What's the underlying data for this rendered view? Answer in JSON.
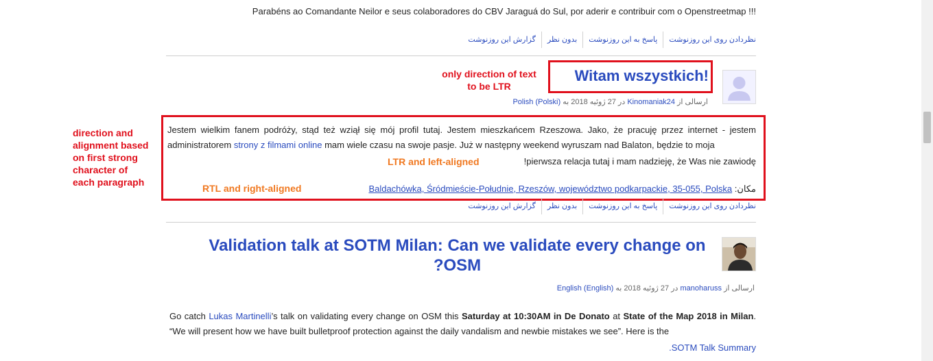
{
  "top_text": "!!! Parabéns ao Comandante Neilor e seus colaboradores do CBV Jaraguá do Sul, por aderir e contribuir com o Openstreetmap",
  "entry_actions": [
    "نظردادن روی این روزنوشت",
    "پاسخ به این روزنوشت",
    "بدون نظر",
    "گزارش این روزنوشت"
  ],
  "post1": {
    "title": "!Witam wszystkich",
    "meta_prefix": "ارسالی از",
    "author": "Kinomaniak24",
    "date": "در 27 ژوئیه 2018 به",
    "language": "Polish (Polski)",
    "body_part1": "Jestem wielkim fanem podróży, stąd też wziął się mój profil tutaj. Jestem mieszkańcem Rzeszowa. Jako, że pracuję przez internet - jestem administratorem",
    "body_link": "strony z filmami online",
    "body_part2": "mam wiele czasu na swoje pasje. Już w następny weekend wyruszam nad Balaton, będzie to moja",
    "body_line3": "!pierwsza relacja tutaj i mam nadzieję, że Was nie zawiodę",
    "location_label": "مکان:",
    "location_value": "Baldachówka, Śródmieście-Południe, Rzeszów, województwo podkarpackie, 35-055, Polska"
  },
  "annotations": {
    "title_note_line1": "only direction of text",
    "title_note_line2": "to be LTR",
    "left_note": [
      "direction and",
      "alignment based",
      "on first strong",
      "character of",
      "each paragraph"
    ],
    "ltr_note": "LTR and left-aligned",
    "rtl_note": "RTL and right-aligned"
  },
  "post2": {
    "title": "Validation talk at SOTM Milan: Can we validate every change on ?OSM",
    "meta_prefix": "ارسالی از",
    "author": "manoharuss",
    "date": "در 27 ژوئیه 2018 به",
    "language": "English (English)",
    "body_intro": "Go catch",
    "body_link": "Lukas Martinelli",
    "body_mid": "’s talk on validating every change on OSM this",
    "body_bold1": "Saturday at 10:30AM in De Donato",
    "body_at": "at",
    "body_bold2": "State of the Map 2018 in",
    "body_bold3": "Milan",
    "body_quote": ". “We will present how we have built bulletproof protection against the daily vandalism and newbie mistakes we see”. Here is the",
    "body_link2": ".SOTM Talk Summary"
  },
  "colors": {
    "link": "#2a4bbe",
    "annotation_red": "#e0101c",
    "annotation_orange": "#f07820"
  }
}
